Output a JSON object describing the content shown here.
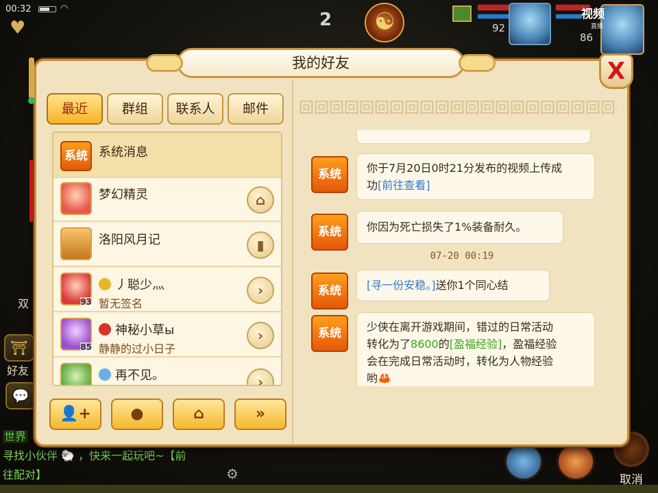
{
  "status": {
    "time": "00:32"
  },
  "hud": {
    "center_number": "2",
    "player_level": "92",
    "target_level": "86",
    "watermark_line1": "视频",
    "watermark_line2": "直播"
  },
  "side": {
    "label_shuang": "双",
    "label_friend": "好友"
  },
  "dialog": {
    "title": "我的好友",
    "close_label": "X"
  },
  "tabs": [
    {
      "label": "最近",
      "active": true
    },
    {
      "label": "群组",
      "active": false
    },
    {
      "label": "联系人",
      "active": false
    },
    {
      "label": "邮件",
      "active": false
    }
  ],
  "contacts": [
    {
      "name": "系统消息",
      "signature": "",
      "level": "",
      "badge": "系统"
    },
    {
      "name": "梦幻精灵",
      "signature": "",
      "level": "",
      "button": "home"
    },
    {
      "name": "洛阳风月记",
      "signature": "",
      "level": "",
      "button": "book"
    },
    {
      "name": "丿聪少灬",
      "signature": "暂无签名",
      "level": "93",
      "button": "chevron"
    },
    {
      "name": "神秘小草ы",
      "signature": "静静的过小日子",
      "level": "85",
      "button": "chevron"
    },
    {
      "name": "再不见。",
      "signature": "",
      "level": "",
      "button": "chevron"
    }
  ],
  "messages": [
    {
      "badge": "系统",
      "text_a": "你于7月20日0时21分发布的视频上传成",
      "text_b": "功",
      "link": "[前往查看]"
    },
    {
      "badge": "系统",
      "text": "你因为死亡损失了1%装备耐久。"
    },
    {
      "time": "07-20 00:19"
    },
    {
      "badge": "系统",
      "link": "[寻一份安稳。]",
      "text": "送你1个同心结"
    },
    {
      "badge": "系统",
      "line1": "少侠在离开游戏期间，错过的日常活动",
      "line2_a": "转化为了",
      "line2_num": "8600",
      "line2_b": "的",
      "line2_link": "[盈福经验]",
      "line2_c": "，盈福经验",
      "line3": "会在完成日常活动时，转化为人物经验",
      "line4": "哟"
    }
  ],
  "chat": {
    "channel": "世界",
    "line1": "寻找小伙伴",
    "line1_b": "，快来一起玩吧~【前",
    "line2": "往配对】"
  },
  "cancel_label": "取消"
}
